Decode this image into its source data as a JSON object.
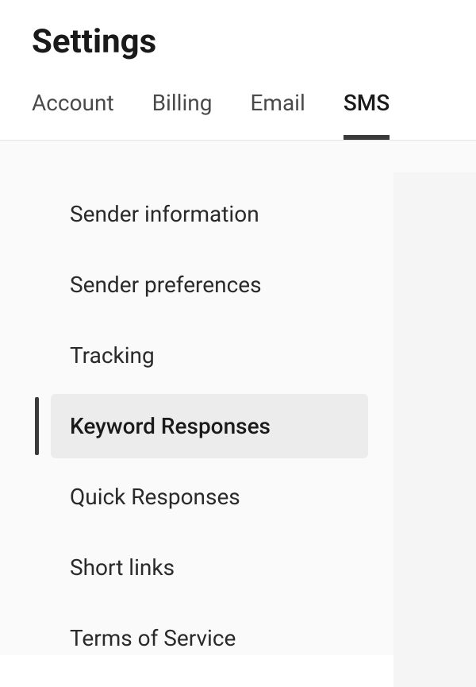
{
  "header": {
    "title": "Settings"
  },
  "tabs": [
    {
      "label": "Account",
      "active": false
    },
    {
      "label": "Billing",
      "active": false
    },
    {
      "label": "Email",
      "active": false
    },
    {
      "label": "SMS",
      "active": true
    }
  ],
  "sideNav": {
    "items": [
      {
        "label": "Sender information",
        "active": false
      },
      {
        "label": "Sender preferences",
        "active": false
      },
      {
        "label": "Tracking",
        "active": false
      },
      {
        "label": "Keyword Responses",
        "active": true
      },
      {
        "label": "Quick Responses",
        "active": false
      },
      {
        "label": "Short links",
        "active": false
      },
      {
        "label": "Terms of Service",
        "active": false
      }
    ]
  }
}
